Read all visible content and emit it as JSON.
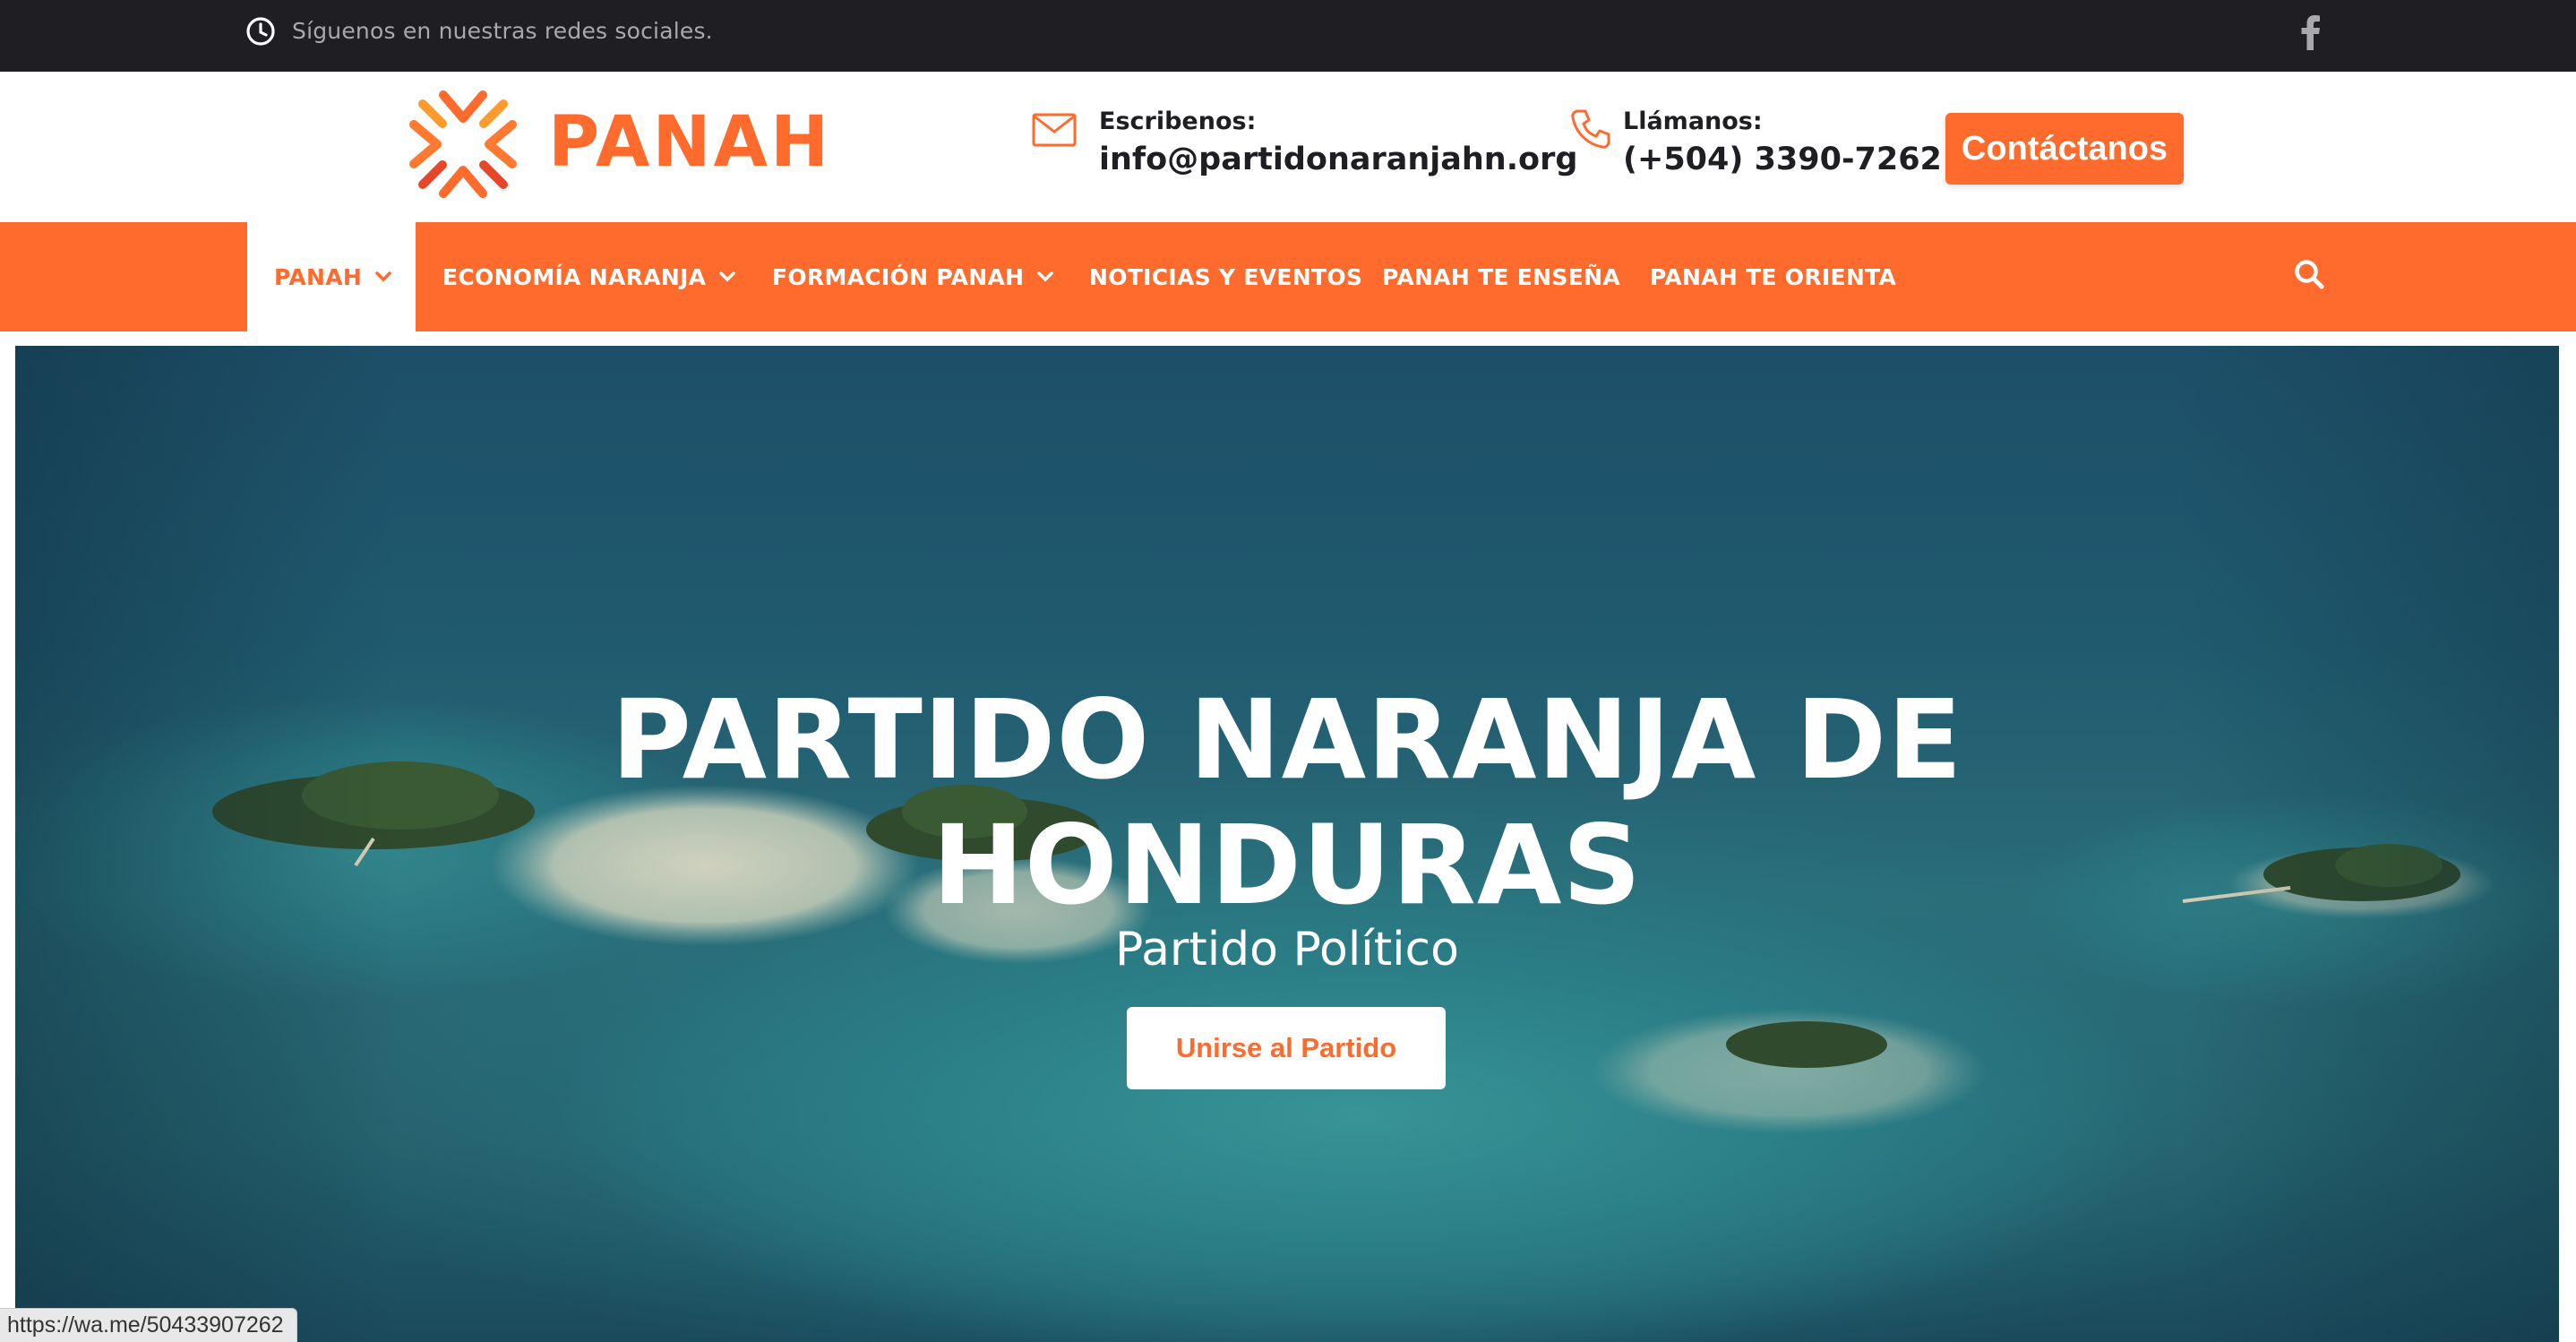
{
  "topbar": {
    "social_text": "Síguenos en nuestras redes sociales.",
    "clock_icon": "clock-icon",
    "facebook_icon": "facebook-icon"
  },
  "brand": {
    "name": "PANAH",
    "color": "#ff6b2c"
  },
  "contact": {
    "email_label": "Escribenos:",
    "email_value": "info@partidonaranjahn.org",
    "phone_label": "Llámanos:",
    "phone_value": "(+504) 3390-7262",
    "cta_label": "Contáctanos"
  },
  "nav": {
    "items": [
      {
        "label": "PANAH",
        "has_dropdown": true,
        "active": true
      },
      {
        "label": "ECONOMÍA NARANJA",
        "has_dropdown": true,
        "active": false
      },
      {
        "label": "FORMACIÓN PANAH",
        "has_dropdown": true,
        "active": false
      },
      {
        "label": "NOTICIAS Y EVENTOS",
        "has_dropdown": false,
        "active": false
      },
      {
        "label": "PANAH TE ENSEÑA",
        "has_dropdown": false,
        "active": false
      },
      {
        "label": "PANAH TE ORIENTA",
        "has_dropdown": false,
        "active": false
      }
    ],
    "search_icon": "search-icon"
  },
  "hero": {
    "title_line1": "PARTIDO NARANJA DE",
    "title_line2": "HONDURAS",
    "subtitle": "Partido Político",
    "button_label": "Unirse al Partido"
  },
  "status_bar": {
    "url": "https://wa.me/50433907262"
  }
}
